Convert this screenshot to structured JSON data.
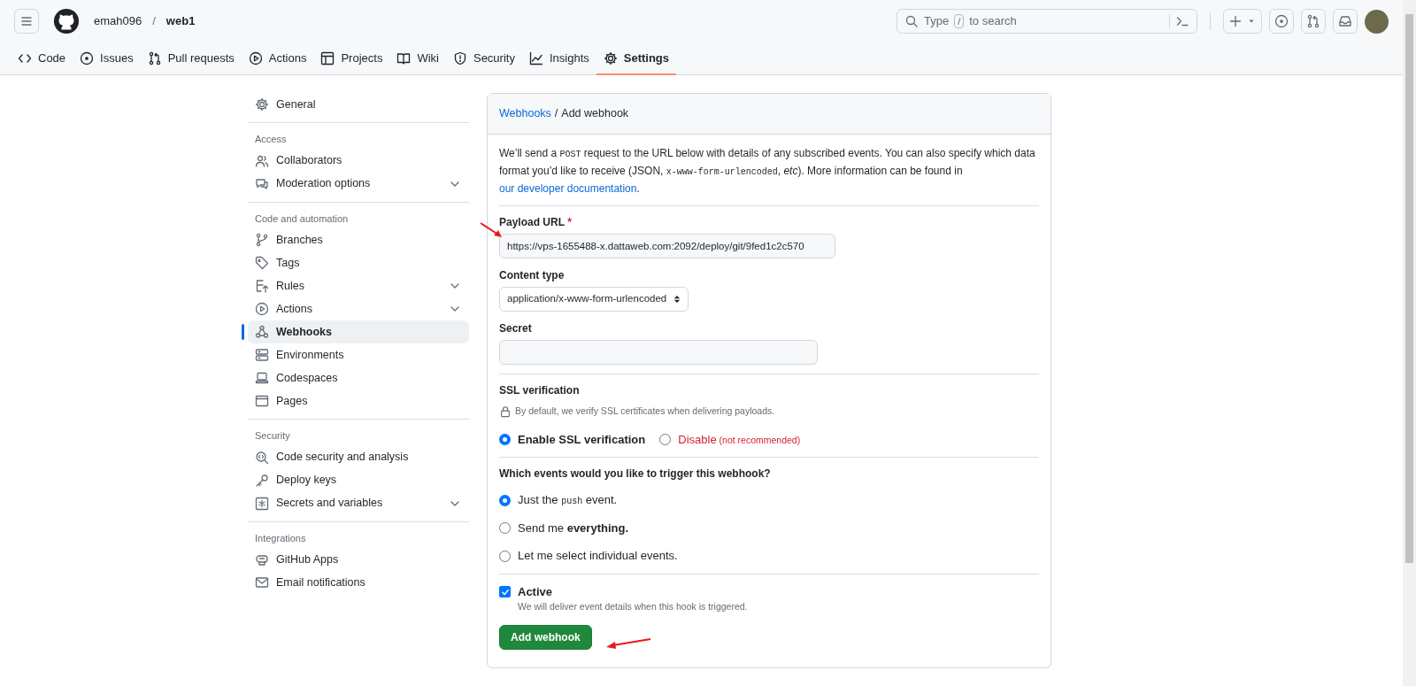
{
  "header": {
    "owner": "emah096",
    "separator": "/",
    "repo": "web1",
    "search": {
      "placeholder_parts": [
        "Type",
        "/",
        "to search"
      ]
    }
  },
  "tabs": [
    {
      "label": "Code",
      "selected": false
    },
    {
      "label": "Issues",
      "selected": false
    },
    {
      "label": "Pull requests",
      "selected": false
    },
    {
      "label": "Actions",
      "selected": false
    },
    {
      "label": "Projects",
      "selected": false
    },
    {
      "label": "Wiki",
      "selected": false
    },
    {
      "label": "Security",
      "selected": false
    },
    {
      "label": "Insights",
      "selected": false
    },
    {
      "label": "Settings",
      "selected": true
    }
  ],
  "sidebar": {
    "sections": [
      {
        "items": [
          {
            "label": "General",
            "selected": false,
            "expandable": false
          }
        ]
      },
      {
        "heading": "Access",
        "items": [
          {
            "label": "Collaborators",
            "selected": false,
            "expandable": false
          },
          {
            "label": "Moderation options",
            "selected": false,
            "expandable": true
          }
        ]
      },
      {
        "heading": "Code and automation",
        "items": [
          {
            "label": "Branches",
            "selected": false,
            "expandable": false
          },
          {
            "label": "Tags",
            "selected": false,
            "expandable": false
          },
          {
            "label": "Rules",
            "selected": false,
            "expandable": true
          },
          {
            "label": "Actions",
            "selected": false,
            "expandable": true
          },
          {
            "label": "Webhooks",
            "selected": true,
            "expandable": false
          },
          {
            "label": "Environments",
            "selected": false,
            "expandable": false
          },
          {
            "label": "Codespaces",
            "selected": false,
            "expandable": false
          },
          {
            "label": "Pages",
            "selected": false,
            "expandable": false
          }
        ]
      },
      {
        "heading": "Security",
        "items": [
          {
            "label": "Code security and analysis",
            "selected": false,
            "expandable": false
          },
          {
            "label": "Deploy keys",
            "selected": false,
            "expandable": false
          },
          {
            "label": "Secrets and variables",
            "selected": false,
            "expandable": true
          }
        ]
      },
      {
        "heading": "Integrations",
        "items": [
          {
            "label": "GitHub Apps",
            "selected": false,
            "expandable": false
          },
          {
            "label": "Email notifications",
            "selected": false,
            "expandable": false
          }
        ]
      }
    ]
  },
  "form": {
    "breadcrumb": {
      "link": "Webhooks",
      "separator": "/",
      "current": "Add webhook"
    },
    "intro": [
      {
        "kind": "text",
        "text": "We’ll send a "
      },
      {
        "kind": "code",
        "text": "POST"
      },
      {
        "kind": "text",
        "text": " request to the URL below with details of any subscribed events. You can also specify which data format you’d like to receive (JSON, "
      },
      {
        "kind": "code",
        "text": "x-www-form-urlencoded"
      },
      {
        "kind": "text",
        "text": ", "
      },
      {
        "kind": "italic",
        "text": "etc"
      },
      {
        "kind": "text",
        "text": "). More information can be found in "
      },
      {
        "kind": "link",
        "text": "our developer documentation"
      },
      {
        "kind": "text",
        "text": "."
      }
    ],
    "payload_url": {
      "label": "Payload URL",
      "required_mark": "*",
      "value": "https://vps-1655488-x.dattaweb.com:2092/deploy/git/9fed1c2c570"
    },
    "content_type": {
      "label": "Content type",
      "value": "application/x-www-form-urlencoded"
    },
    "secret": {
      "label": "Secret"
    },
    "ssl": {
      "heading": "SSL verification",
      "note": "By default, we verify SSL certificates when delivering payloads.",
      "options": [
        {
          "kind": "normal",
          "selected": true,
          "parts": [
            {
              "kind": "bold",
              "text": "Enable SSL verification"
            }
          ]
        },
        {
          "kind": "danger",
          "selected": false,
          "parts": [
            {
              "kind": "text",
              "text": "Disable"
            },
            {
              "kind": "note",
              "text": " (not recommended)"
            }
          ]
        }
      ]
    },
    "events": {
      "question": "Which events would you like to trigger this webhook?",
      "options": [
        {
          "selected": true,
          "parts": [
            {
              "kind": "text",
              "text": "Just the "
            },
            {
              "kind": "code",
              "text": "push"
            },
            {
              "kind": "text",
              "text": " event."
            }
          ]
        },
        {
          "selected": false,
          "parts": [
            {
              "kind": "text",
              "text": "Send me "
            },
            {
              "kind": "bold",
              "text": "everything."
            }
          ]
        },
        {
          "selected": false,
          "parts": [
            {
              "kind": "text",
              "text": "Let me select individual events."
            }
          ]
        }
      ]
    },
    "active": {
      "label": "Active",
      "checked": true,
      "note": "We will deliver event details when this hook is triggered."
    },
    "submit": "Add webhook"
  }
}
